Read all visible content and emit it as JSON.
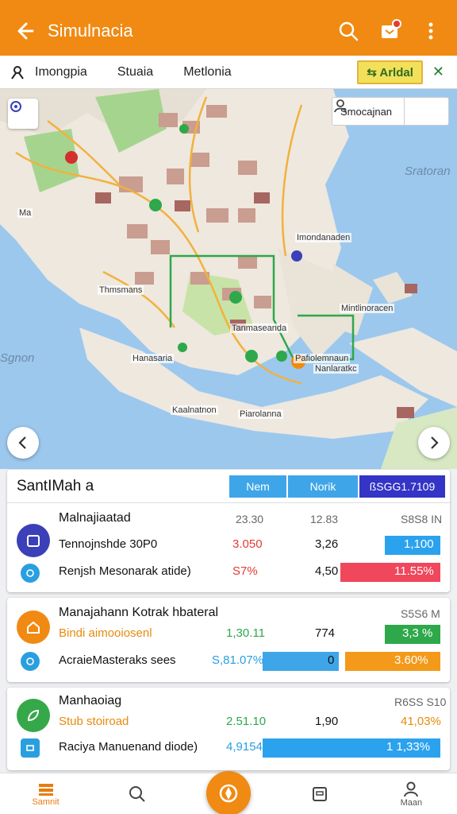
{
  "app": {
    "title": "Simulnacia"
  },
  "filters": {
    "tabs": [
      "Imongpia",
      "Stuaia",
      "Metlonia"
    ],
    "action_button": "Arldal",
    "close": "✕"
  },
  "map": {
    "search_label": "Smocajnan",
    "sea_labels": [
      "Sratoran",
      "Sgnon"
    ],
    "place_labels": [
      "Imondanaden",
      "Mintlinoracen",
      "Thmsmans",
      "Hanasaria",
      "Kaalnatnon",
      "Piarolanna",
      "Pafiolemnaun",
      "Nanlaratkc",
      "Ma",
      "Tanmaseanda"
    ]
  },
  "summary": {
    "title": "SantIMah a",
    "chips": [
      "Nem",
      "Norik",
      "ßSGG1.7109"
    ],
    "chip_colors": [
      "#3ea6e8",
      "#3ea6e8",
      "#3434c6"
    ]
  },
  "cards": [
    {
      "title": "Malnajiaatad",
      "head_values": [
        "23.30",
        "12.83",
        "S8S8 IN"
      ],
      "rows": [
        {
          "label": "Tennojnshde 30P0",
          "v1": "3.050",
          "v2": "3,26",
          "bar_label": "1,100",
          "bar_color": "#2ba2ee"
        },
        {
          "label": "Renjsh Mesonarak atide)",
          "v1": "S7%",
          "v2": "4,50",
          "bar_label": "11.55%",
          "bar_color": "#f0475c"
        }
      ],
      "icon_color": "#3b3fb8",
      "small_color": "#2a9fe0"
    },
    {
      "title": "Manajahann Kotrak hbateral",
      "head_values": [
        "",
        "",
        "S5S6 M"
      ],
      "rows": [
        {
          "label": "Bindi aimooiosenl",
          "v1": "1,30.11",
          "v2": "774",
          "bar_label": "3,3 %",
          "bar_color": "#2ea84a"
        },
        {
          "label": "AcraieMasteraks sees",
          "v1": "S,81.07%",
          "v2": "0",
          "bar_label": "3.60%",
          "bar_color": "#f39a1a"
        }
      ],
      "icon_color": "#f08a12",
      "small_color": "#2a9fe0"
    },
    {
      "title": "Manhaoiag",
      "head_values": [
        "",
        "",
        "R6SS S10"
      ],
      "rows": [
        {
          "label": "Stub stoiroad",
          "v1": "2.51.10",
          "v2": "1,90",
          "bar_label": "41,03%",
          "bar_color": "#ffffff"
        },
        {
          "label": "Raciya Manuenand diode)",
          "v1": "4,9154",
          "v2": "",
          "bar_label": "1 1,33%",
          "bar_color": "#2ba2ee"
        }
      ],
      "icon_color": "#35a849",
      "small_color": "#2a9fe0"
    }
  ],
  "bottom_nav": {
    "items": [
      "Samnit",
      "",
      "",
      "",
      "Maan"
    ]
  }
}
